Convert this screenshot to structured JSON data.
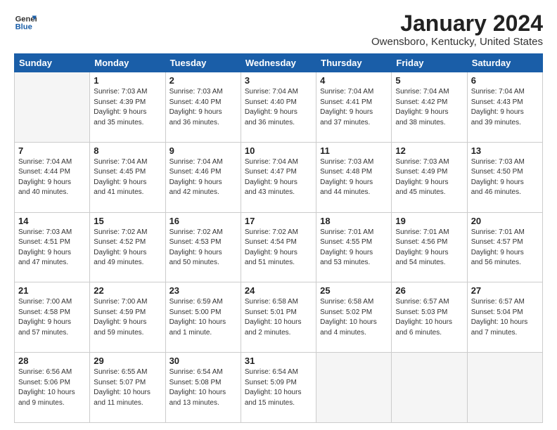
{
  "logo": {
    "line1": "General",
    "line2": "Blue"
  },
  "title": "January 2024",
  "location": "Owensboro, Kentucky, United States",
  "weekdays": [
    "Sunday",
    "Monday",
    "Tuesday",
    "Wednesday",
    "Thursday",
    "Friday",
    "Saturday"
  ],
  "weeks": [
    [
      {
        "day": "",
        "info": ""
      },
      {
        "day": "1",
        "info": "Sunrise: 7:03 AM\nSunset: 4:39 PM\nDaylight: 9 hours\nand 35 minutes."
      },
      {
        "day": "2",
        "info": "Sunrise: 7:03 AM\nSunset: 4:40 PM\nDaylight: 9 hours\nand 36 minutes."
      },
      {
        "day": "3",
        "info": "Sunrise: 7:04 AM\nSunset: 4:40 PM\nDaylight: 9 hours\nand 36 minutes."
      },
      {
        "day": "4",
        "info": "Sunrise: 7:04 AM\nSunset: 4:41 PM\nDaylight: 9 hours\nand 37 minutes."
      },
      {
        "day": "5",
        "info": "Sunrise: 7:04 AM\nSunset: 4:42 PM\nDaylight: 9 hours\nand 38 minutes."
      },
      {
        "day": "6",
        "info": "Sunrise: 7:04 AM\nSunset: 4:43 PM\nDaylight: 9 hours\nand 39 minutes."
      }
    ],
    [
      {
        "day": "7",
        "info": "Sunrise: 7:04 AM\nSunset: 4:44 PM\nDaylight: 9 hours\nand 40 minutes."
      },
      {
        "day": "8",
        "info": "Sunrise: 7:04 AM\nSunset: 4:45 PM\nDaylight: 9 hours\nand 41 minutes."
      },
      {
        "day": "9",
        "info": "Sunrise: 7:04 AM\nSunset: 4:46 PM\nDaylight: 9 hours\nand 42 minutes."
      },
      {
        "day": "10",
        "info": "Sunrise: 7:04 AM\nSunset: 4:47 PM\nDaylight: 9 hours\nand 43 minutes."
      },
      {
        "day": "11",
        "info": "Sunrise: 7:03 AM\nSunset: 4:48 PM\nDaylight: 9 hours\nand 44 minutes."
      },
      {
        "day": "12",
        "info": "Sunrise: 7:03 AM\nSunset: 4:49 PM\nDaylight: 9 hours\nand 45 minutes."
      },
      {
        "day": "13",
        "info": "Sunrise: 7:03 AM\nSunset: 4:50 PM\nDaylight: 9 hours\nand 46 minutes."
      }
    ],
    [
      {
        "day": "14",
        "info": "Sunrise: 7:03 AM\nSunset: 4:51 PM\nDaylight: 9 hours\nand 47 minutes."
      },
      {
        "day": "15",
        "info": "Sunrise: 7:02 AM\nSunset: 4:52 PM\nDaylight: 9 hours\nand 49 minutes."
      },
      {
        "day": "16",
        "info": "Sunrise: 7:02 AM\nSunset: 4:53 PM\nDaylight: 9 hours\nand 50 minutes."
      },
      {
        "day": "17",
        "info": "Sunrise: 7:02 AM\nSunset: 4:54 PM\nDaylight: 9 hours\nand 51 minutes."
      },
      {
        "day": "18",
        "info": "Sunrise: 7:01 AM\nSunset: 4:55 PM\nDaylight: 9 hours\nand 53 minutes."
      },
      {
        "day": "19",
        "info": "Sunrise: 7:01 AM\nSunset: 4:56 PM\nDaylight: 9 hours\nand 54 minutes."
      },
      {
        "day": "20",
        "info": "Sunrise: 7:01 AM\nSunset: 4:57 PM\nDaylight: 9 hours\nand 56 minutes."
      }
    ],
    [
      {
        "day": "21",
        "info": "Sunrise: 7:00 AM\nSunset: 4:58 PM\nDaylight: 9 hours\nand 57 minutes."
      },
      {
        "day": "22",
        "info": "Sunrise: 7:00 AM\nSunset: 4:59 PM\nDaylight: 9 hours\nand 59 minutes."
      },
      {
        "day": "23",
        "info": "Sunrise: 6:59 AM\nSunset: 5:00 PM\nDaylight: 10 hours\nand 1 minute."
      },
      {
        "day": "24",
        "info": "Sunrise: 6:58 AM\nSunset: 5:01 PM\nDaylight: 10 hours\nand 2 minutes."
      },
      {
        "day": "25",
        "info": "Sunrise: 6:58 AM\nSunset: 5:02 PM\nDaylight: 10 hours\nand 4 minutes."
      },
      {
        "day": "26",
        "info": "Sunrise: 6:57 AM\nSunset: 5:03 PM\nDaylight: 10 hours\nand 6 minutes."
      },
      {
        "day": "27",
        "info": "Sunrise: 6:57 AM\nSunset: 5:04 PM\nDaylight: 10 hours\nand 7 minutes."
      }
    ],
    [
      {
        "day": "28",
        "info": "Sunrise: 6:56 AM\nSunset: 5:06 PM\nDaylight: 10 hours\nand 9 minutes."
      },
      {
        "day": "29",
        "info": "Sunrise: 6:55 AM\nSunset: 5:07 PM\nDaylight: 10 hours\nand 11 minutes."
      },
      {
        "day": "30",
        "info": "Sunrise: 6:54 AM\nSunset: 5:08 PM\nDaylight: 10 hours\nand 13 minutes."
      },
      {
        "day": "31",
        "info": "Sunrise: 6:54 AM\nSunset: 5:09 PM\nDaylight: 10 hours\nand 15 minutes."
      },
      {
        "day": "",
        "info": ""
      },
      {
        "day": "",
        "info": ""
      },
      {
        "day": "",
        "info": ""
      }
    ]
  ]
}
